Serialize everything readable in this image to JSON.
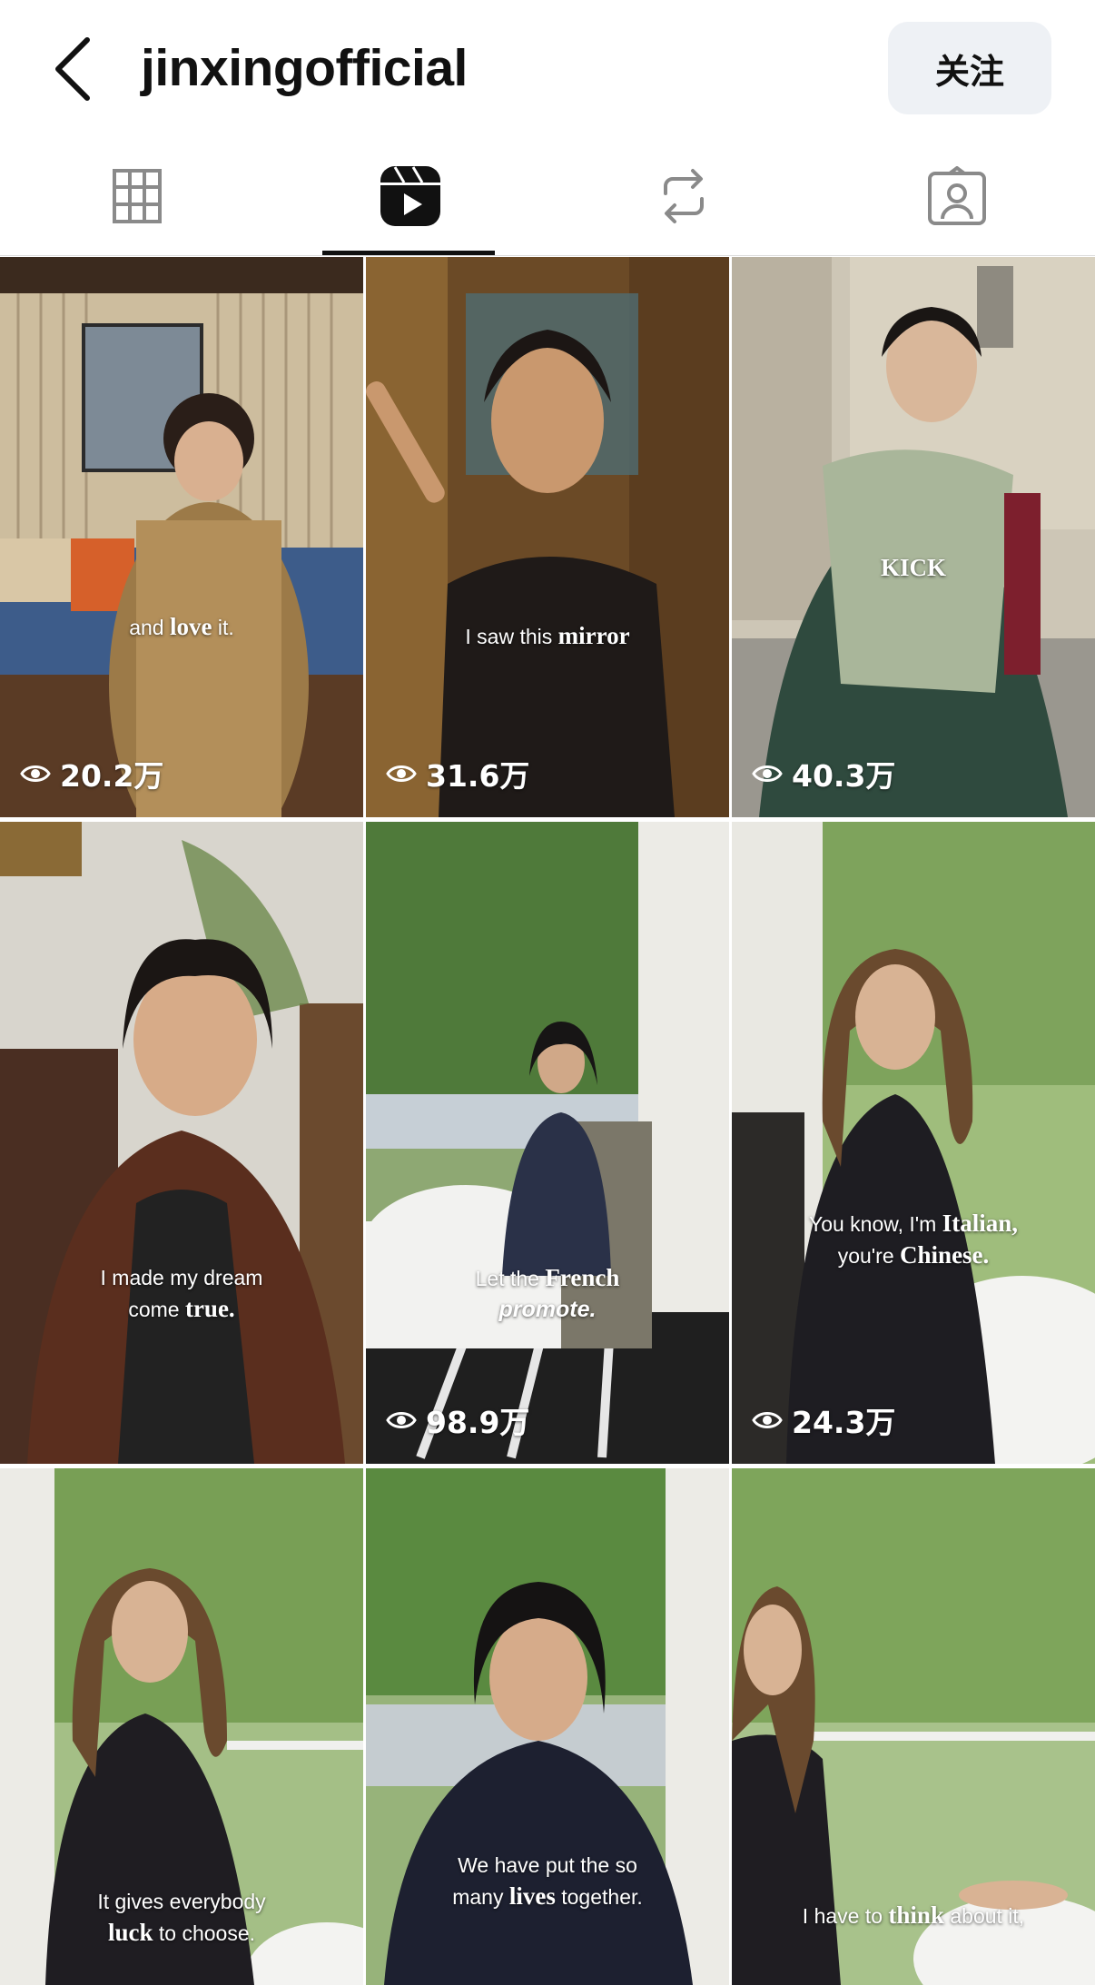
{
  "header": {
    "username": "jinxingofficial",
    "follow_label": "关注"
  },
  "tabs": [
    {
      "name": "posts-grid",
      "icon": "grid-icon"
    },
    {
      "name": "reels",
      "icon": "reels-icon",
      "active": true
    },
    {
      "name": "reposts",
      "icon": "repost-icon"
    },
    {
      "name": "tagged",
      "icon": "tagged-person-icon"
    }
  ],
  "reels": [
    {
      "subtitle_pre": "and ",
      "subtitle_em": "love",
      "subtitle_post": " it.",
      "views": "20.2万"
    },
    {
      "subtitle_pre": "I saw this ",
      "subtitle_em": "mirror",
      "subtitle_post": "",
      "views": "31.6万"
    },
    {
      "subtitle_pre": "",
      "subtitle_em": "KICK",
      "subtitle_post": "",
      "views": "40.3万"
    },
    {
      "subtitle_line1": "I made my dream",
      "subtitle_line2_pre": "come ",
      "subtitle_line2_em": "true.",
      "views": ""
    },
    {
      "subtitle_line1_pre": "Let the ",
      "subtitle_line1_em": "French",
      "subtitle_line2": "promote.",
      "views": "98.9万"
    },
    {
      "subtitle_line1_pre": "You know, I'm ",
      "subtitle_line1_em": "Italian,",
      "subtitle_line2_pre": "you're ",
      "subtitle_line2_em": "Chinese.",
      "views": "24.3万"
    },
    {
      "subtitle_line1": "It gives everybody",
      "subtitle_line2_em": "luck",
      "subtitle_line2_post": " to choose.",
      "views": ""
    },
    {
      "subtitle_line1": "We have put the so",
      "subtitle_line2_pre": "many ",
      "subtitle_line2_em": "lives",
      "subtitle_line2_post": " together.",
      "views": ""
    },
    {
      "subtitle_line1_pre": "I have to ",
      "subtitle_line1_em": "think",
      "subtitle_line1_post": " about it,",
      "views": ""
    }
  ]
}
